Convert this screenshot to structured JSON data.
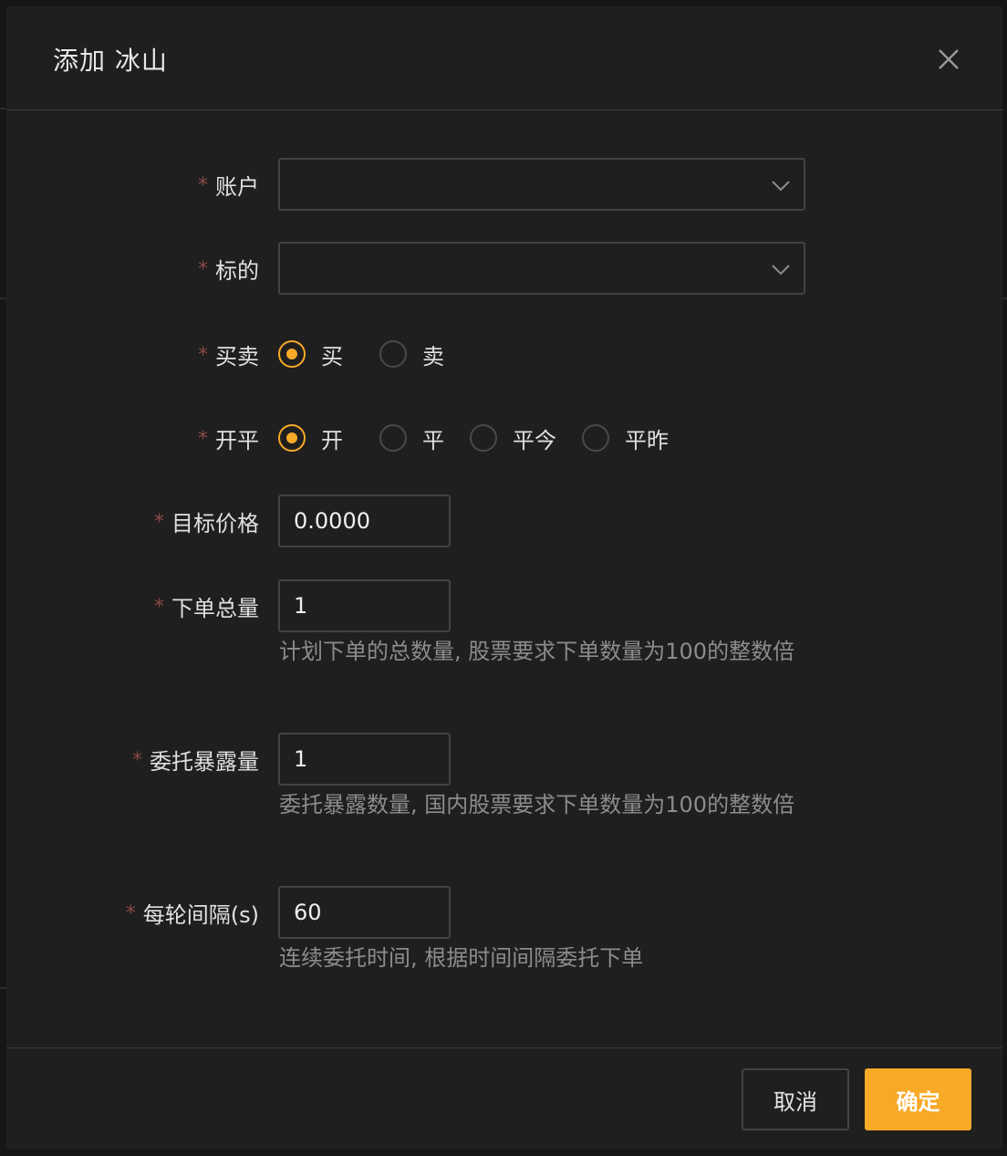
{
  "dialog": {
    "title": "添加 冰山"
  },
  "form": {
    "account": {
      "label": "账户",
      "value": ""
    },
    "symbol": {
      "label": "标的",
      "value": ""
    },
    "side": {
      "label": "买卖",
      "options": [
        "买",
        "卖"
      ],
      "selected": "买"
    },
    "offset": {
      "label": "开平",
      "options": [
        "开",
        "平",
        "平今",
        "平昨"
      ],
      "selected": "开"
    },
    "target_price": {
      "label": "目标价格",
      "value": "0.0000"
    },
    "total_qty": {
      "label": "下单总量",
      "value": "1",
      "help": "计划下单的总数量, 股票要求下单数量为100的整数倍"
    },
    "exposure_qty": {
      "label": "委托暴露量",
      "value": "1",
      "help": "委托暴露数量, 国内股票要求下单数量为100的整数倍"
    },
    "interval": {
      "label": "每轮间隔(s)",
      "value": "60",
      "help": "连续委托时间, 根据时间间隔委托下单"
    },
    "required_mark": "*"
  },
  "footer": {
    "cancel_label": "取消",
    "ok_label": "确定"
  },
  "colors": {
    "accent": "#f7a928",
    "background": "#1f1f1f",
    "border": "#434343",
    "help_text": "#8c8c8c",
    "required": "#8a4a46"
  },
  "icons": {
    "close": "close-icon",
    "dropdown": "chevron-down-icon"
  }
}
